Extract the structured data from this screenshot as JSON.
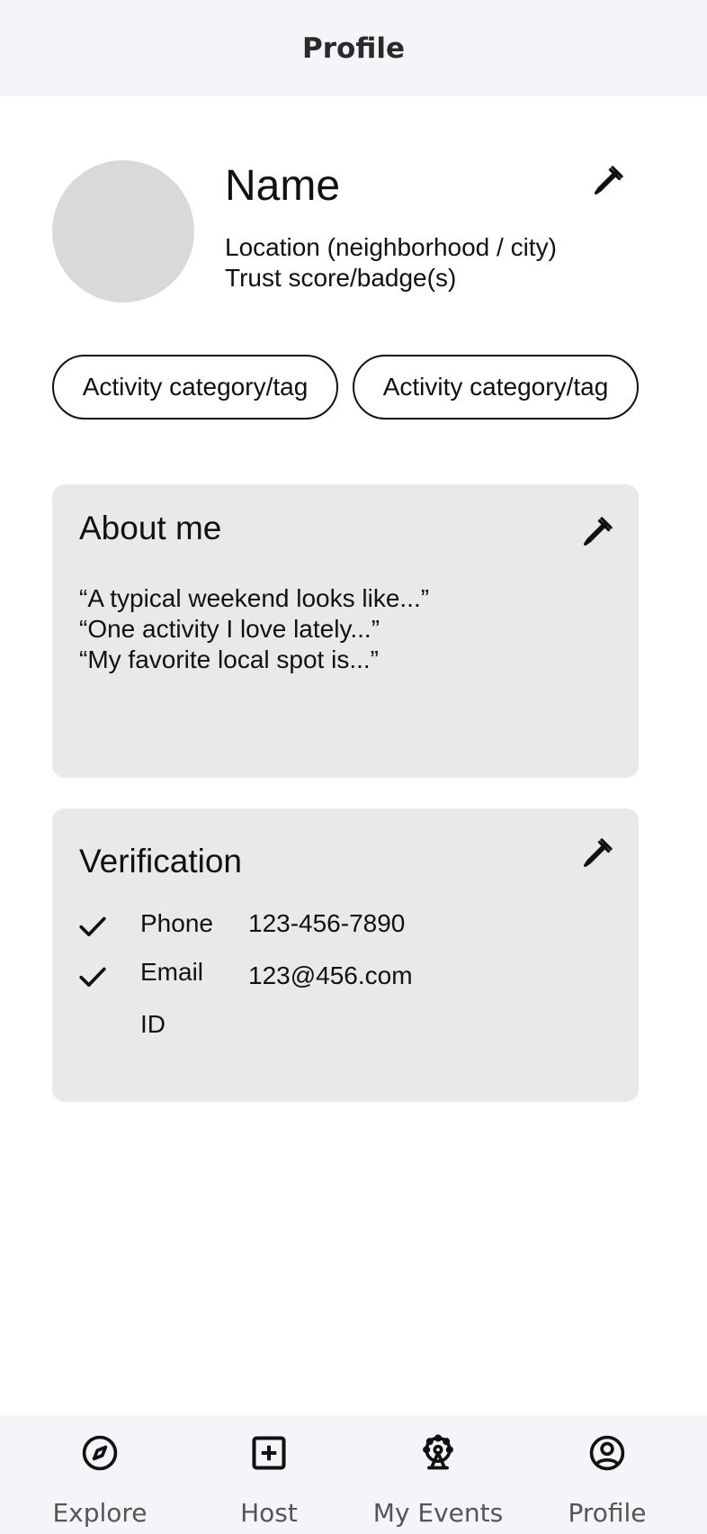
{
  "header": {
    "title": "Profile"
  },
  "profile": {
    "name": "Name",
    "location": "Location (neighborhood / city)",
    "trust": "Trust score/badge(s)",
    "edit_icon": "pencil-icon"
  },
  "tags": [
    "Activity category/tag",
    "Activity category/tag"
  ],
  "about": {
    "title": "About me",
    "lines": [
      "“A typical weekend looks like...”",
      "“One activity I love lately...”",
      "“My favorite local spot is...”"
    ]
  },
  "verification": {
    "title": "Verification",
    "items": [
      {
        "label": "Phone",
        "value": "123-456-7890",
        "verified": true
      },
      {
        "label": "Email",
        "value": "123@456.com",
        "verified": true
      },
      {
        "label": "ID",
        "value": "",
        "verified": false
      }
    ]
  },
  "nav": {
    "items": [
      {
        "label": "Explore",
        "icon": "compass-icon"
      },
      {
        "label": "Host",
        "icon": "plus-square-icon"
      },
      {
        "label": "My Events",
        "icon": "ferris-wheel-icon"
      },
      {
        "label": "Profile",
        "icon": "user-circle-icon"
      }
    ]
  },
  "colors": {
    "header_bg": "#f4f5f8",
    "card_bg": "#e9e9e9",
    "avatar_bg": "#d9d9d9",
    "nav_label": "#555555"
  }
}
